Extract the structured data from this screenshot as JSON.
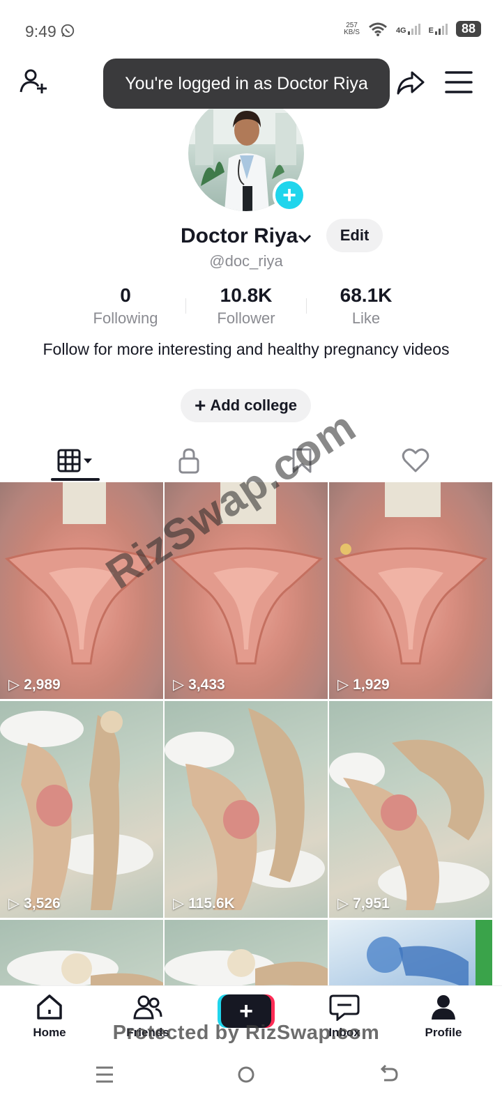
{
  "status_bar": {
    "time": "9:49",
    "net_speed_value": "257",
    "net_speed_unit": "KB/S",
    "network_1": "4G",
    "network_2": "E",
    "battery": "88"
  },
  "toast": {
    "text": "You're logged in as Doctor Riya"
  },
  "profile": {
    "display_name": "Doctor Riya",
    "edit_label": "Edit",
    "handle": "@doc_riya",
    "bio": "Follow for more interesting and healthy pregnancy videos",
    "add_college_label": "Add college"
  },
  "stats": {
    "following": {
      "value": "0",
      "label": "Following"
    },
    "followers": {
      "value": "10.8K",
      "label": "Follower"
    },
    "likes": {
      "value": "68.1K",
      "label": "Like"
    }
  },
  "tabs": [
    {
      "icon": "grid-icon",
      "active": true
    },
    {
      "icon": "lock-icon",
      "active": false
    },
    {
      "icon": "bookmark-icon",
      "active": false
    },
    {
      "icon": "heart-icon",
      "active": false
    }
  ],
  "videos": [
    {
      "views": "2,989",
      "thumb": "uterus"
    },
    {
      "views": "3,433",
      "thumb": "uterus"
    },
    {
      "views": "1,929",
      "thumb": "uterus"
    },
    {
      "views": "3,526",
      "thumb": "sleeping-pregnant-skeleton"
    },
    {
      "views": "115.6K",
      "thumb": "sleeping-pregnant-skeleton"
    },
    {
      "views": "7,951",
      "thumb": "sleeping-pregnant-skeleton"
    },
    {
      "views": "",
      "thumb": "sleeping-skeleton"
    },
    {
      "views": "",
      "thumb": "sleeping-skeleton"
    },
    {
      "views": "",
      "thumb": "blue-xray-skeleton"
    }
  ],
  "watermark": "RizSwap.com",
  "bottom_nav": {
    "home": "Home",
    "friends": "Friends",
    "inbox": "Inbox",
    "profile": "Profile"
  },
  "protected_text": "Protected by RizSwap.com",
  "colors": {
    "accent_cyan": "#20d5ec",
    "accent_red": "#fe2c55",
    "text_primary": "#161823",
    "text_secondary": "#8a8b91"
  }
}
